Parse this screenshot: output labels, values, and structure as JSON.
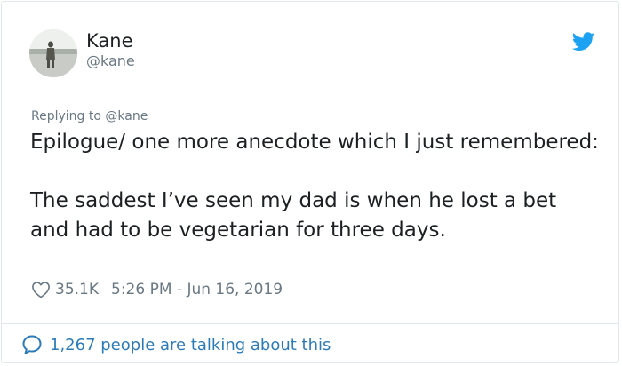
{
  "author": {
    "name": "Kane",
    "handle": "@kane"
  },
  "reply_to": "Replying to @kane",
  "tweet": {
    "paragraphs": [
      "Epilogue/ one more anecdote which I just remembered:",
      "The saddest I’ve seen my dad is when he lost a bet and had to be vegetarian for three days."
    ]
  },
  "meta": {
    "likes": "35.1K",
    "timestamp": "5:26 PM - Jun 16, 2019"
  },
  "footer": {
    "conversation_text": "1,267 people are talking about this"
  },
  "icons": {
    "brand": "twitter-bird-icon",
    "like": "heart-icon",
    "reply": "speech-bubble-icon"
  },
  "colors": {
    "twitter_blue": "#1da1f2",
    "link_blue": "#2b7bb9",
    "secondary_text": "#697882",
    "primary_text": "#1c2022",
    "border": "#e1e8ed"
  }
}
